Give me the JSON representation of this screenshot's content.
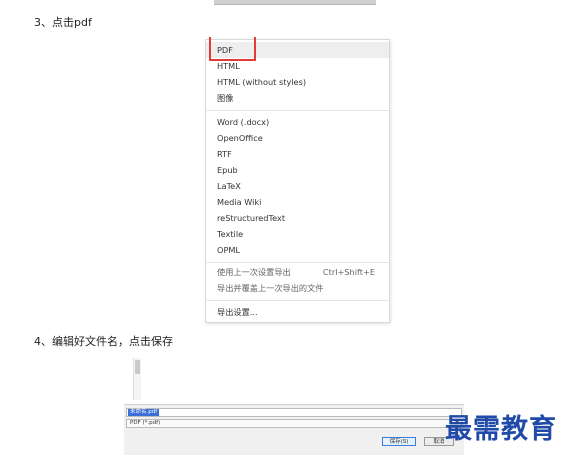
{
  "steps": {
    "step3": "3、点击pdf",
    "step4": "4、编辑好文件名，点击保存"
  },
  "menu": {
    "group1": [
      "PDF",
      "HTML",
      "HTML (without styles)",
      "图像"
    ],
    "group2": [
      "Word (.docx)",
      "OpenOffice",
      "RTF",
      "Epub",
      "LaTeX",
      "Media Wiki",
      "reStructuredText",
      "Textile",
      "OPML"
    ],
    "group3": [
      "使用上一次设置导出",
      "导出并覆盖上一次导出的文件"
    ],
    "group3_shortcut": "Ctrl+Shift+E",
    "group4": [
      "导出设置..."
    ],
    "highlighted": "PDF"
  },
  "dialog": {
    "filename": "未命名.pdf",
    "filetype": "PDF (*.pdf)",
    "save_label": "保存(S)",
    "cancel_label": "取消"
  },
  "watermark": "最需教育",
  "colors": {
    "highlight_box": "#e03a3a",
    "watermark": "#1f4aa8",
    "selection": "#3a6fd8"
  }
}
